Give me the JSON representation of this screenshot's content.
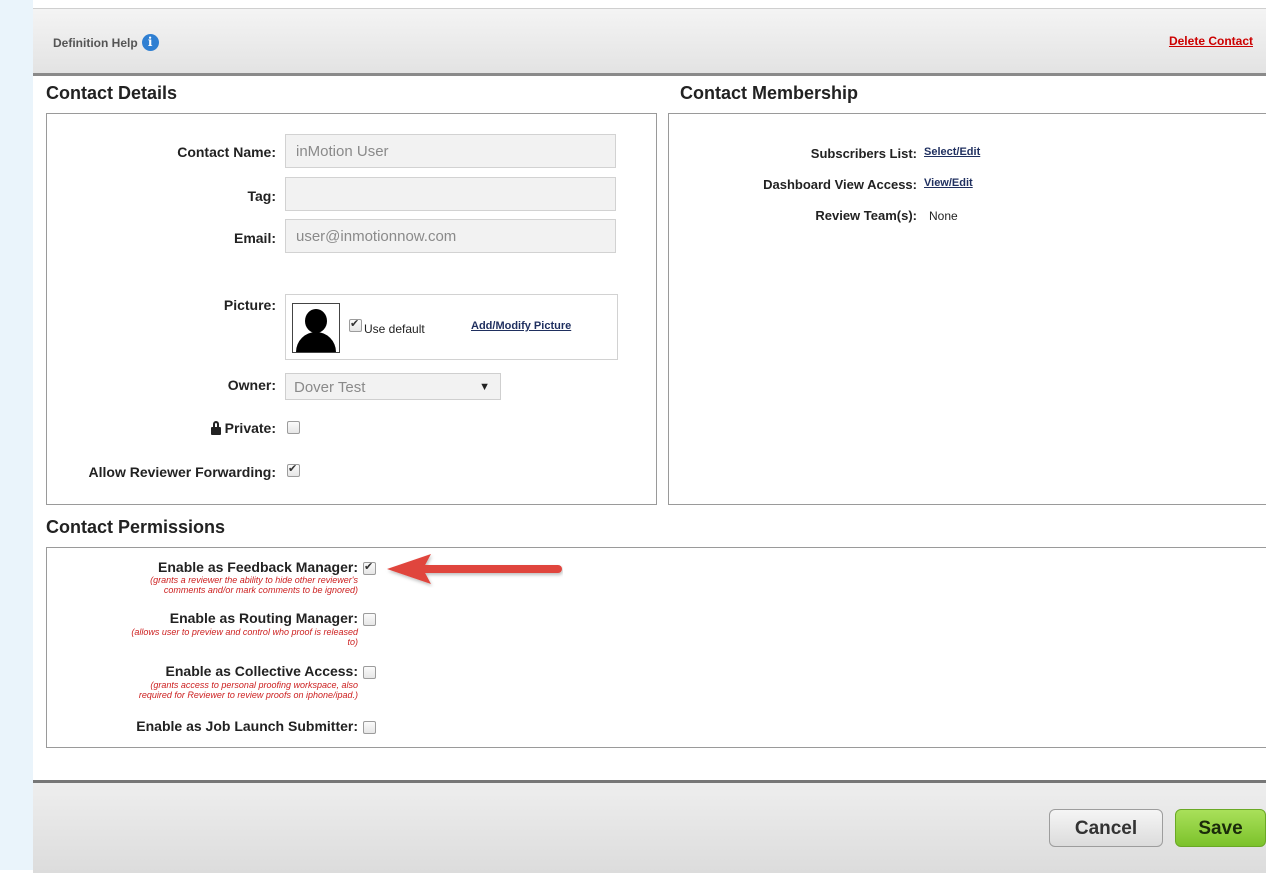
{
  "header": {
    "definition_help": "Definition Help",
    "delete_contact": "Delete Contact"
  },
  "contact_details": {
    "title": "Contact Details",
    "name_label": "Contact Name:",
    "name_value": "inMotion User",
    "tag_label": "Tag:",
    "tag_value": "",
    "email_label": "Email:",
    "email_value": "user@inmotionnow.com",
    "picture_label": "Picture:",
    "use_default_label": "Use default",
    "use_default_checked": true,
    "add_modify_picture": "Add/Modify Picture",
    "owner_label": "Owner:",
    "owner_value": "Dover Test",
    "private_label": "Private:",
    "private_checked": false,
    "allow_forwarding_label": "Allow Reviewer Forwarding:",
    "allow_forwarding_checked": true
  },
  "contact_membership": {
    "title": "Contact Membership",
    "subscribers_label": "Subscribers List:",
    "subscribers_link": "Select/Edit",
    "dashboard_label": "Dashboard View Access:",
    "dashboard_link": "View/Edit",
    "review_team_label": "Review Team(s):",
    "review_team_value": "None"
  },
  "contact_permissions": {
    "title": "Contact Permissions",
    "items": [
      {
        "label": "Enable as Feedback Manager:",
        "note_line1": "(grants a reviewer the ability to hide other reviewer's",
        "note_line2": "comments and/or mark comments to be ignored)",
        "checked": true
      },
      {
        "label": "Enable as Routing Manager:",
        "note_line1": "(allows user to preview and control who proof is released",
        "note_line2": "to)",
        "checked": false
      },
      {
        "label": "Enable as Collective Access:",
        "note_line1": "(grants access to personal proofing workspace, also",
        "note_line2": "required for Reviewer to review proofs on iphone/ipad.)",
        "checked": false
      },
      {
        "label": "Enable as Job Launch Submitter:",
        "note_line1": "",
        "note_line2": "",
        "checked": false
      }
    ]
  },
  "footer": {
    "cancel_label": "Cancel",
    "save_label": "Save"
  },
  "colors": {
    "link_red": "#cc0000",
    "note_red": "#cc1f1f",
    "save_green": "#7cc22b",
    "arrow_red": "#e0453e"
  }
}
